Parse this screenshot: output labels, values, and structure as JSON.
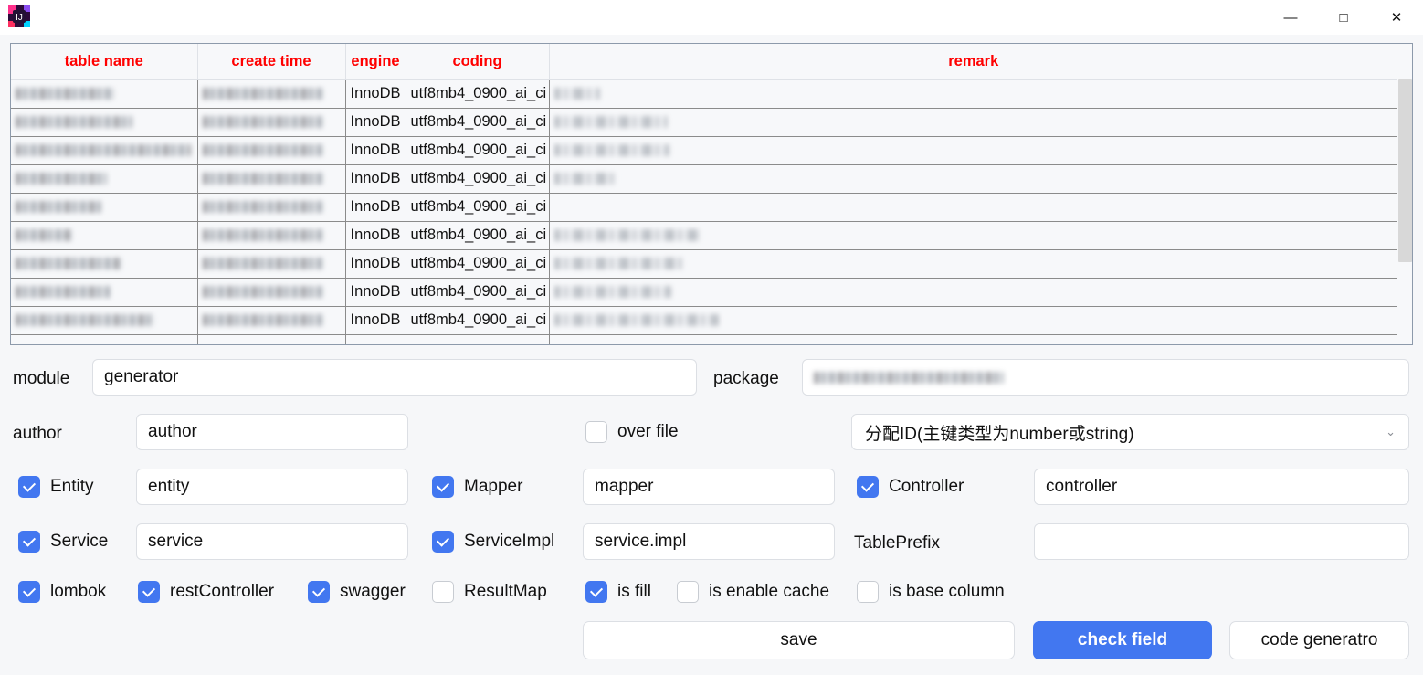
{
  "window": {
    "app_icon": "intellij-idea-icon",
    "minimize_label": "—",
    "maximize_label": "□",
    "close_label": "✕"
  },
  "table": {
    "columns": [
      "table name",
      "create time",
      "engine",
      "coding",
      "remark"
    ],
    "rows": [
      {
        "name": "",
        "create_time": "",
        "engine": "InnoDB",
        "coding": "utf8mb4_0900_ai_ci",
        "remark": "",
        "name_w": 108,
        "time_w": 132,
        "remark_w": 50
      },
      {
        "name": "",
        "create_time": "",
        "engine": "InnoDB",
        "coding": "utf8mb4_0900_ai_ci",
        "remark": "",
        "name_w": 128,
        "time_w": 132,
        "remark_w": 124
      },
      {
        "name": "",
        "create_time": "",
        "engine": "InnoDB",
        "coding": "utf8mb4_0900_ai_ci",
        "remark": "",
        "name_w": 192,
        "time_w": 132,
        "remark_w": 126
      },
      {
        "name": "",
        "create_time": "",
        "engine": "InnoDB",
        "coding": "utf8mb4_0900_ai_ci",
        "remark": "",
        "name_w": 100,
        "time_w": 132,
        "remark_w": 68
      },
      {
        "name": "",
        "create_time": "",
        "engine": "InnoDB",
        "coding": "utf8mb4_0900_ai_ci",
        "remark": "",
        "name_w": 94,
        "time_w": 132,
        "remark_w": 0
      },
      {
        "name": "",
        "create_time": "",
        "engine": "InnoDB",
        "coding": "utf8mb4_0900_ai_ci",
        "remark": "",
        "name_w": 62,
        "time_w": 132,
        "remark_w": 160
      },
      {
        "name": "",
        "create_time": "",
        "engine": "InnoDB",
        "coding": "utf8mb4_0900_ai_ci",
        "remark": "",
        "name_w": 116,
        "time_w": 132,
        "remark_w": 140
      },
      {
        "name": "",
        "create_time": "",
        "engine": "InnoDB",
        "coding": "utf8mb4_0900_ai_ci",
        "remark": "",
        "name_w": 104,
        "time_w": 132,
        "remark_w": 128
      },
      {
        "name": "",
        "create_time": "",
        "engine": "InnoDB",
        "coding": "utf8mb4_0900_ai_ci",
        "remark": "",
        "name_w": 152,
        "time_w": 132,
        "remark_w": 180
      },
      {
        "name": "",
        "create_time": "",
        "engine": "",
        "coding": "",
        "remark": "",
        "name_w": 0,
        "time_w": 0,
        "remark_w": 0
      }
    ]
  },
  "form": {
    "module_label": "module",
    "module_value": "generator",
    "package_label": "package",
    "package_value": "",
    "author_label": "author",
    "author_value": "author",
    "over_file_label": "over file",
    "over_file_checked": false,
    "id_type_selected": "分配ID(主键类型为number或string)",
    "id_type_chevron": "⌄",
    "entity_label": "Entity",
    "entity_value": "entity",
    "entity_checked": true,
    "mapper_label": "Mapper",
    "mapper_value": "mapper",
    "mapper_checked": true,
    "controller_label": "Controller",
    "controller_value": "controller",
    "controller_checked": true,
    "service_label": "Service",
    "service_value": "service",
    "service_checked": true,
    "service_impl_label": "ServiceImpl",
    "service_impl_value": "service.impl",
    "service_impl_checked": true,
    "table_prefix_label": "TablePrefix",
    "table_prefix_value": "",
    "lombok_label": "lombok",
    "lombok_checked": true,
    "rest_controller_label": "restController",
    "rest_controller_checked": true,
    "swagger_label": "swagger",
    "swagger_checked": true,
    "result_map_label": "ResultMap",
    "result_map_checked": false,
    "is_fill_label": "is fill",
    "is_fill_checked": true,
    "is_enable_cache_label": "is enable cache",
    "is_enable_cache_checked": false,
    "is_base_column_label": "is base column",
    "is_base_column_checked": false,
    "save_label": "save",
    "check_field_label": "check field",
    "code_generator_label": "code generatro"
  },
  "colors": {
    "accent": "#4277f0",
    "header_text": "#ff0000",
    "background": "#f6f7f9",
    "border": "#dcdfe4"
  }
}
